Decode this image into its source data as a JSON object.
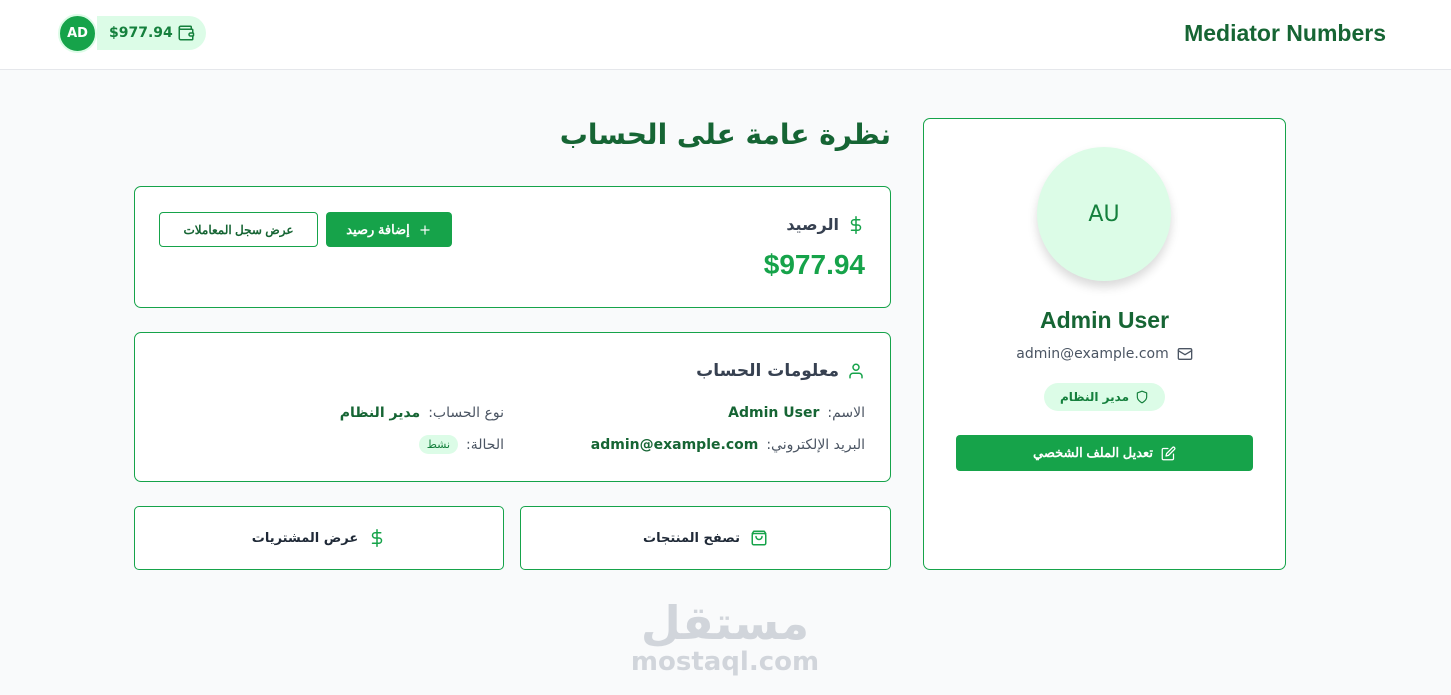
{
  "header": {
    "brand": "Mediator Numbers",
    "avatar_initials": "AD",
    "wallet_balance": "$977.94"
  },
  "profile": {
    "initials": "AU",
    "name": "Admin User",
    "email": "admin@example.com",
    "role": "مدير النظام",
    "edit_label": "تعديل الملف الشخصي"
  },
  "page": {
    "title": "نظرة عامة على الحساب"
  },
  "balance": {
    "label": "الرصيد",
    "amount": "$977.94",
    "add_label": "إضافة رصيد",
    "history_label": "عرض سجل المعاملات"
  },
  "account": {
    "title": "معلومات الحساب",
    "name_label": "الاسم:",
    "name_value": "Admin User",
    "email_label": "البريد الإلكتروني:",
    "email_value": "admin@example.com",
    "type_label": "نوع الحساب:",
    "type_value": "مدير النظام",
    "status_label": "الحالة:",
    "status_value": "نشط"
  },
  "actions": {
    "browse_label": "تصفح المنتجات",
    "purchases_label": "عرض المشتريات"
  },
  "watermark": {
    "arabic": "مستقل",
    "latin": "mostaql.com"
  },
  "colors": {
    "primary": "#16a34a",
    "dark_green": "#166534",
    "light_green": "#dcfce7"
  }
}
